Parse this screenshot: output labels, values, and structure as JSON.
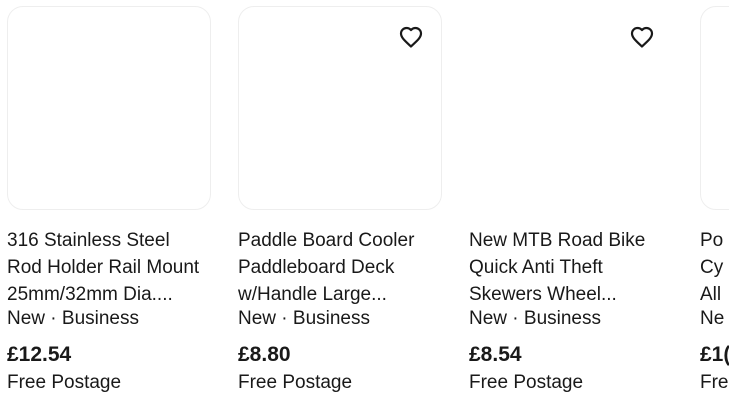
{
  "items": [
    {
      "title_lines": [
        "316 Stainless Steel",
        "Rod Holder Rail Mount",
        "25mm/32mm Dia...."
      ],
      "condition": "New · Business",
      "price": "£12.54",
      "shipping": "Free Postage",
      "watch_icon": "none"
    },
    {
      "title_lines": [
        "Paddle Board Cooler",
        "Paddleboard Deck",
        "w/Handle Large..."
      ],
      "condition": "New · Business",
      "price": "£8.80",
      "shipping": "Free Postage",
      "watch_icon": "heart-outline-icon"
    },
    {
      "title_lines": [
        "New MTB Road Bike",
        "Quick Anti Theft",
        "Skewers Wheel..."
      ],
      "condition": "New · Business",
      "price": "£8.54",
      "shipping": "Free Postage",
      "watch_icon": "heart-outline-icon"
    },
    {
      "title_lines": [
        "Po",
        "Cy",
        "All"
      ],
      "condition": "Ne",
      "price": "£1(",
      "shipping": "Fre",
      "watch_icon": "none"
    }
  ],
  "colors": {
    "text": "#191919",
    "image_border": "#eeeeee",
    "background": "#ffffff"
  }
}
